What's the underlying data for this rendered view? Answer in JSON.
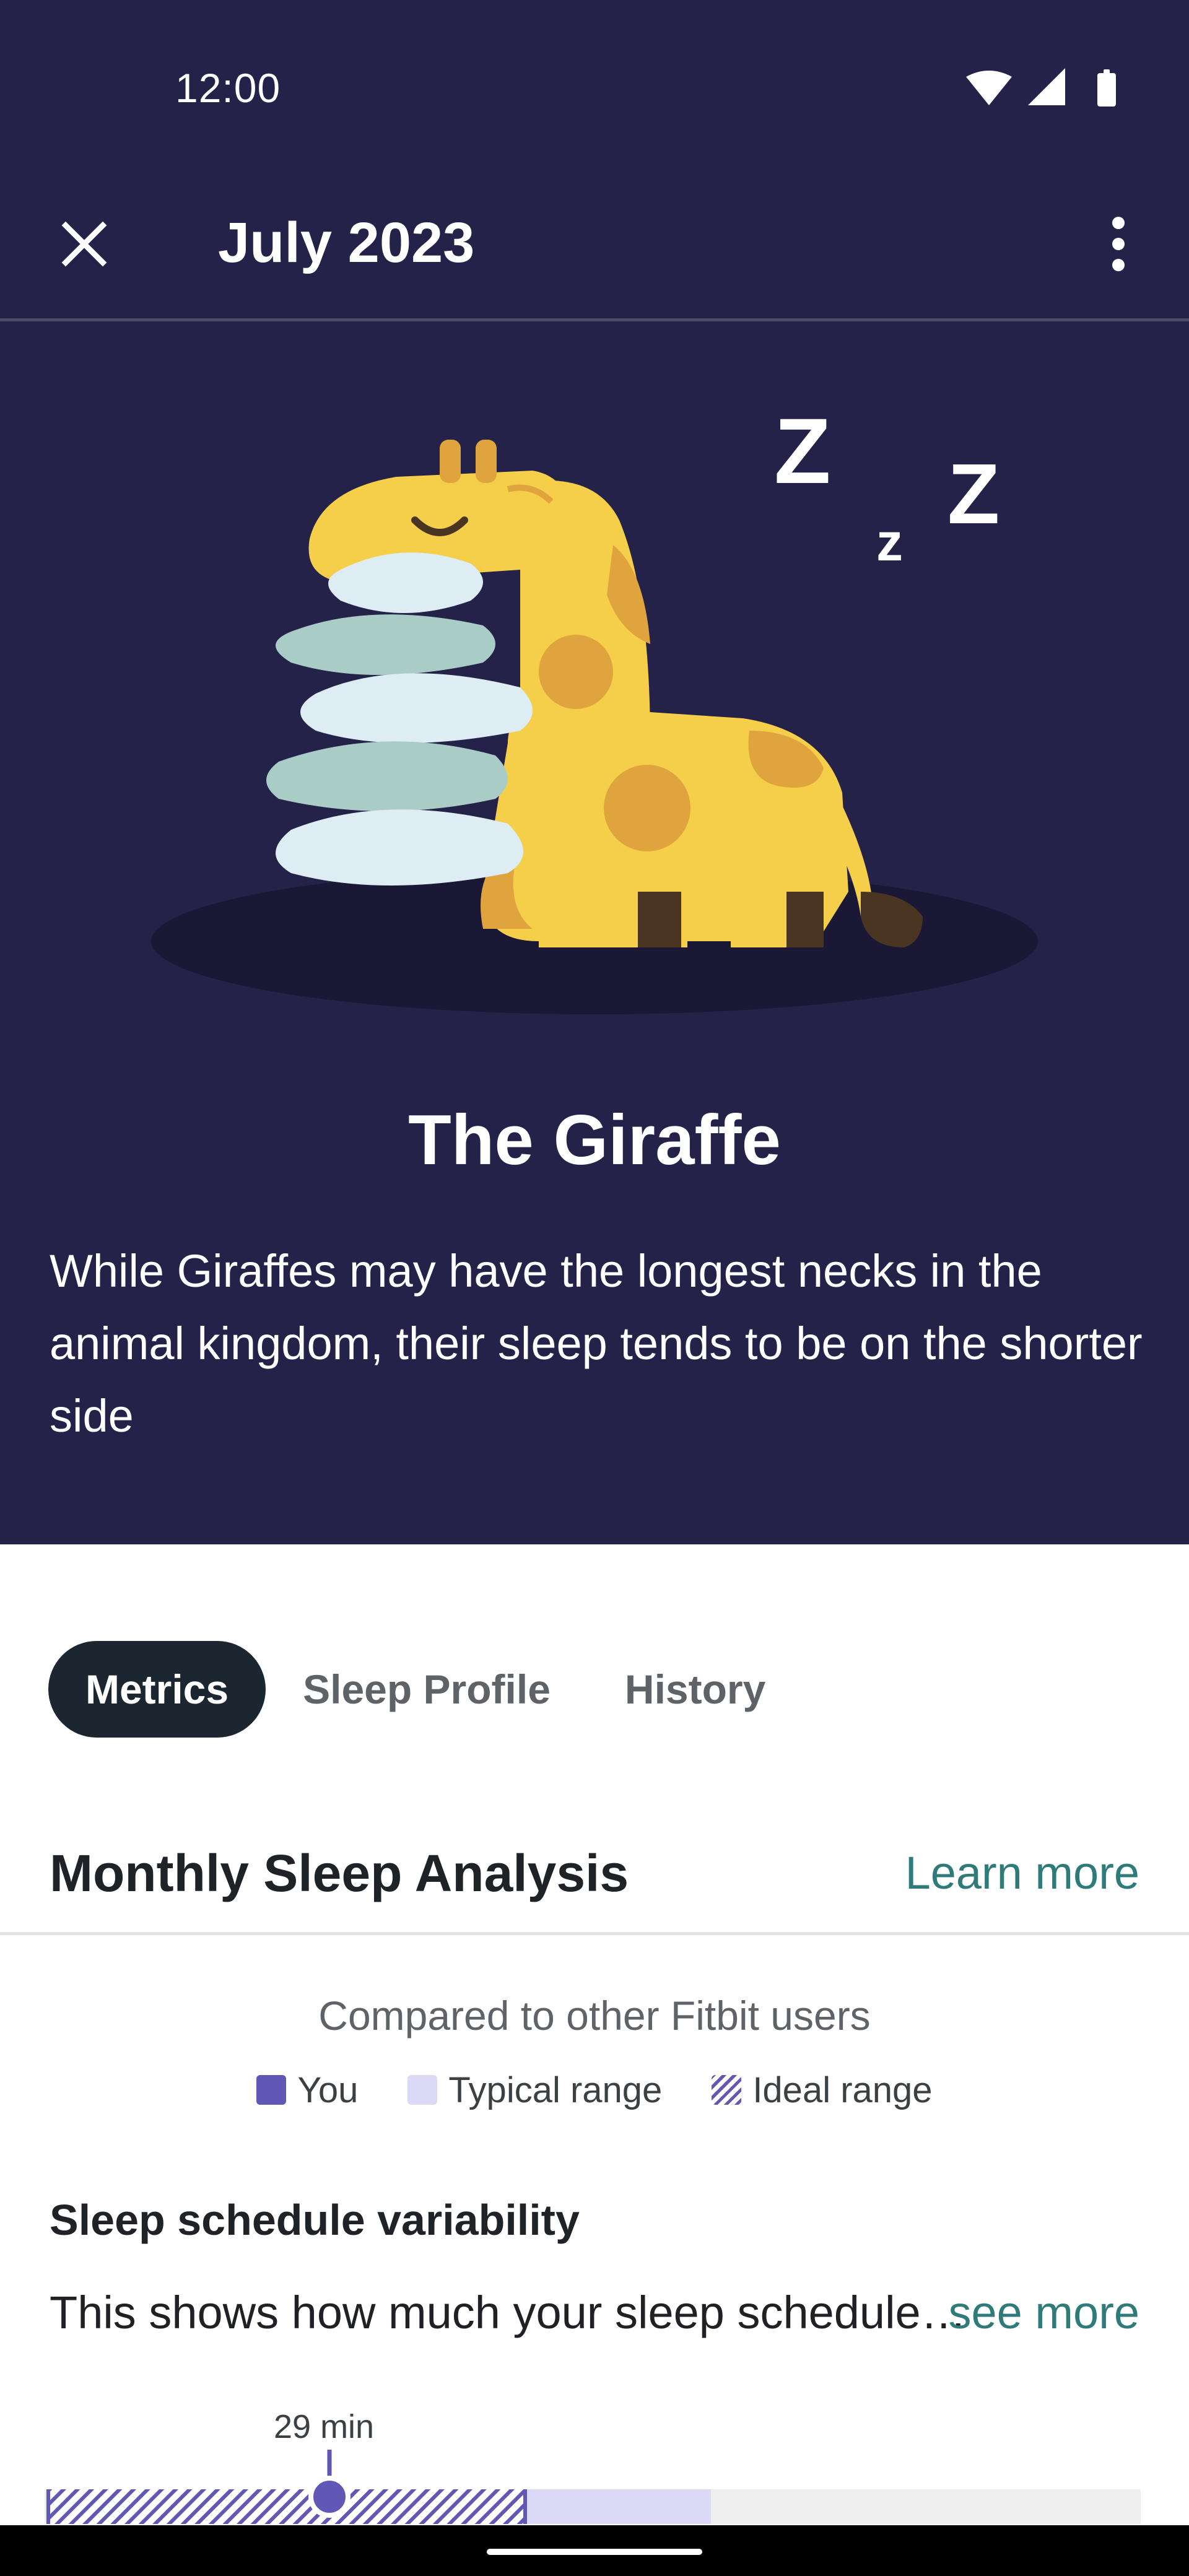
{
  "status_bar": {
    "time": "12:00",
    "icons": [
      "wifi-icon",
      "signal-icon",
      "battery-icon"
    ]
  },
  "app_bar": {
    "title": "July 2023",
    "close_icon": "close-icon",
    "menu_icon": "more-vert-icon"
  },
  "hero": {
    "illustration": "sleeping-giraffe-illustration",
    "sleep_letters": [
      "Z",
      "z",
      "Z"
    ],
    "title": "The Giraffe",
    "description": "While Giraffes may have the longest necks in the animal kingdom, their sleep tends to be on the shorter side"
  },
  "tabs": [
    {
      "label": "Metrics",
      "active": true
    },
    {
      "label": "Sleep Profile",
      "active": false
    },
    {
      "label": "History",
      "active": false
    }
  ],
  "analysis": {
    "title": "Monthly Sleep Analysis",
    "learn_more": "Learn more",
    "compared_label": "Compared to other Fitbit users",
    "legend": [
      {
        "label": "You",
        "color": "#6157b4"
      },
      {
        "label": "Typical range",
        "color": "#dcd9f6"
      },
      {
        "label": "Ideal range",
        "pattern": "hatched",
        "color": "#6157b4"
      }
    ]
  },
  "metric": {
    "title": "Sleep schedule variability",
    "description": "This shows how much your sleep schedule varies from night to night",
    "see_more": "see more",
    "value_label": "29 min"
  },
  "colors": {
    "hero_background": "#25224a",
    "accent_teal": "#2f7b7a",
    "you_purple": "#6157b4",
    "typical_lavender": "#dcd9f6",
    "active_tab": "#1b2631"
  }
}
